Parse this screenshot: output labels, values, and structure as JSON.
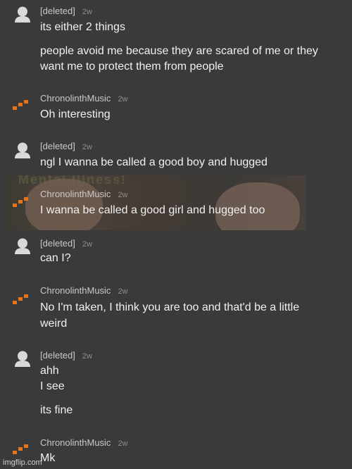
{
  "comments": [
    {
      "author": "[deleted]",
      "time": "2w",
      "lines": [
        "its either 2 things",
        "people avoid me because they are scared of me or they",
        "want me to protect them from people"
      ]
    },
    {
      "author": "ChronolinthMusic",
      "time": "2w",
      "lines": [
        "Oh interesting"
      ]
    },
    {
      "author": "[deleted]",
      "time": "2w",
      "lines": [
        "ngl I wanna be called a good boy and hugged"
      ]
    },
    {
      "author": "ChronolinthMusic",
      "time": "2w",
      "lines": [
        "I wanna be called a good girl and hugged too"
      ]
    },
    {
      "author": "[deleted]",
      "time": "2w",
      "lines": [
        "can I?"
      ]
    },
    {
      "author": "ChronolinthMusic",
      "time": "2w",
      "lines": [
        "No I'm taken, I think you are too and that'd be a little",
        "weird"
      ]
    },
    {
      "author": "[deleted]",
      "time": "2w",
      "lines": [
        "ahh",
        "I see",
        "its fine"
      ]
    },
    {
      "author": "ChronolinthMusic",
      "time": "2w",
      "lines": [
        "Mk"
      ]
    }
  ],
  "overlay_banner": "Mental Illness!",
  "watermark": "imgflip.com",
  "colors": {
    "background": "#3a3a3a",
    "accent_orange": "#e8751a",
    "avatar_gray": "#d9d9d9"
  },
  "icons": {
    "deleted_avatar": "user-silhouette-icon",
    "chronolinth_avatar": "pixel-logo-icon"
  }
}
